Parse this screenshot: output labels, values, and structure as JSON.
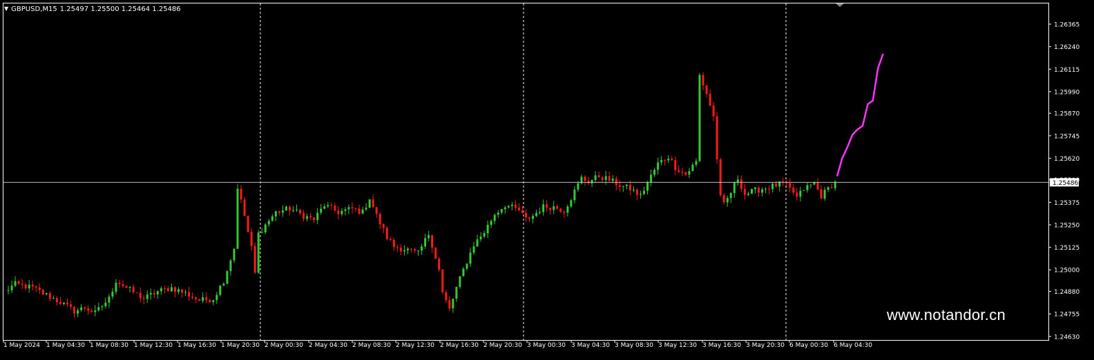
{
  "header": {
    "symbol": "GBPUSD,M15",
    "ohlc": "1.25497 1.25500 1.25464 1.25486"
  },
  "watermark": "www.notandor.cn",
  "colors": {
    "background": "#000000",
    "axis": "#ffffff",
    "bull": "#33cc33",
    "bear": "#ff1a1a",
    "bid_line": "#c0c0c0",
    "forecast": "#ff33ff"
  },
  "chart_data": {
    "type": "candlestick",
    "symbol": "GBPUSD",
    "timeframe": "M15",
    "y_ticks": [
      "1.26365",
      "1.26240",
      "1.26115",
      "1.25990",
      "1.25870",
      "1.25745",
      "1.25620",
      "1.25500",
      "1.25375",
      "1.25250",
      "1.25125",
      "1.25000",
      "1.24880",
      "1.24755",
      "1.24630"
    ],
    "ylim": [
      1.2461,
      1.2648
    ],
    "current_price": "1.25486",
    "x_ticks": [
      "1 May 2024",
      "1 May 04:30",
      "1 May 08:30",
      "1 May 12:30",
      "1 May 16:30",
      "1 May 20:30",
      "2 May 00:30",
      "2 May 04:30",
      "2 May 08:30",
      "2 May 12:30",
      "2 May 16:30",
      "2 May 20:30",
      "3 May 00:30",
      "3 May 04:30",
      "3 May 08:30",
      "3 May 12:30",
      "3 May 16:30",
      "3 May 20:30",
      "6 May 00:30",
      "6 May 04:30"
    ],
    "day_separators": [
      "2 May 00:00",
      "3 May 00:00",
      "6 May 00:00"
    ],
    "price_path": [
      [
        0,
        1.2488
      ],
      [
        3,
        1.2492
      ],
      [
        8,
        1.249
      ],
      [
        12,
        1.2486
      ],
      [
        16,
        1.2482
      ],
      [
        20,
        1.2477
      ],
      [
        23,
        1.2479
      ],
      [
        26,
        1.2476
      ],
      [
        30,
        1.2484
      ],
      [
        32,
        1.2494
      ],
      [
        35,
        1.249
      ],
      [
        40,
        1.2484
      ],
      [
        44,
        1.2488
      ],
      [
        48,
        1.249
      ],
      [
        52,
        1.2487
      ],
      [
        56,
        1.2483
      ],
      [
        60,
        1.2484
      ],
      [
        63,
        1.2494
      ],
      [
        66,
        1.2512
      ],
      [
        67,
        1.2546
      ],
      [
        69,
        1.253
      ],
      [
        71,
        1.2512
      ],
      [
        72,
        1.2498
      ],
      [
        73,
        1.252
      ],
      [
        75,
        1.2525
      ],
      [
        78,
        1.2532
      ],
      [
        82,
        1.2534
      ],
      [
        86,
        1.253
      ],
      [
        89,
        1.2528
      ],
      [
        92,
        1.2536
      ],
      [
        96,
        1.2532
      ],
      [
        100,
        1.2534
      ],
      [
        103,
        1.2532
      ],
      [
        105,
        1.254
      ],
      [
        107,
        1.253
      ],
      [
        110,
        1.2518
      ],
      [
        112,
        1.2513
      ],
      [
        116,
        1.2511
      ],
      [
        119,
        1.2509
      ],
      [
        122,
        1.252
      ],
      [
        123,
        1.2514
      ],
      [
        125,
        1.25
      ],
      [
        126,
        1.2487
      ],
      [
        128,
        1.2478
      ],
      [
        130,
        1.249
      ],
      [
        132,
        1.25
      ],
      [
        135,
        1.2514
      ],
      [
        138,
        1.2521
      ],
      [
        141,
        1.2531
      ],
      [
        144,
        1.2536
      ],
      [
        148,
        1.2533
      ],
      [
        150,
        1.2528
      ],
      [
        152,
        1.253
      ],
      [
        155,
        1.2535
      ],
      [
        158,
        1.2535
      ],
      [
        161,
        1.2533
      ],
      [
        163,
        1.254
      ],
      [
        166,
        1.2551
      ],
      [
        168,
        1.2549
      ],
      [
        171,
        1.2552
      ],
      [
        174,
        1.255
      ],
      [
        177,
        1.2547
      ],
      [
        180,
        1.2545
      ],
      [
        183,
        1.2541
      ],
      [
        186,
        1.2552
      ],
      [
        188,
        1.2559
      ],
      [
        191,
        1.2563
      ],
      [
        193,
        1.2557
      ],
      [
        196,
        1.2553
      ],
      [
        199,
        1.256
      ],
      [
        200,
        1.2608
      ],
      [
        202,
        1.2598
      ],
      [
        204,
        1.2585
      ],
      [
        205,
        1.2562
      ],
      [
        206,
        1.254
      ],
      [
        207,
        1.2536
      ],
      [
        209,
        1.2543
      ],
      [
        211,
        1.2551
      ],
      [
        213,
        1.2542
      ],
      [
        216,
        1.2544
      ],
      [
        220,
        1.2546
      ],
      [
        224,
        1.2548
      ],
      [
        227,
        1.2543
      ],
      [
        228,
        1.254
      ],
      [
        230,
        1.2545
      ],
      [
        233,
        1.2548
      ],
      [
        235,
        1.2541
      ],
      [
        238,
        1.2547
      ],
      [
        240,
        1.255
      ]
    ],
    "path_bars": 240,
    "forecast": [
      [
        0,
        1.2552
      ],
      [
        2,
        1.2562
      ],
      [
        4,
        1.2568
      ],
      [
        6,
        1.2575
      ],
      [
        8,
        1.2578
      ],
      [
        10,
        1.258
      ],
      [
        12,
        1.2592
      ],
      [
        14,
        1.2594
      ],
      [
        16,
        1.2612
      ],
      [
        18,
        1.262
      ]
    ]
  }
}
